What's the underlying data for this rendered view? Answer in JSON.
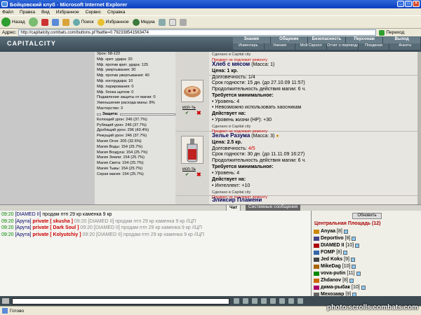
{
  "window": {
    "title": "Бойцовский клуб - Microsoft Internet Explorer"
  },
  "menu": [
    "Файл",
    "Правка",
    "Вид",
    "Избранное",
    "Сервис",
    "Справка"
  ],
  "toolbar": {
    "back": "Назад",
    "search": "Поиск",
    "favorites": "Избранное",
    "media": "Медиа"
  },
  "address": {
    "label": "Адрес:",
    "value": "http://capitalcity.combats.com/buttons.pl?battle=0.792338541563474",
    "go": "Переход"
  },
  "site": {
    "logo": "CAPITALCITY",
    "nav_top": [
      "Знания",
      "Общение",
      "Безопасность",
      "Персонаж",
      "Выход"
    ],
    "nav_bottom": [
      "Инвентарь",
      "Умения",
      "Мой Скролл",
      "Отчет о переводах",
      "Поединки",
      "Анкета"
    ]
  },
  "stats": {
    "lines_a": [
      "Урон: 58-122",
      "Мф. крит. удара: 20",
      "Мф. против крит. удара: 125",
      "Мф. увертывания: 30",
      "Мф. против увертывания: 40",
      "Мф. контрудара: 10",
      "Мф. парирования: 0",
      "Мф. блока щитом: 0",
      "Подавление защиты от магии: 0",
      "Уменьшение расхода маны: 8%",
      "Мастерство: 3"
    ],
    "protection": "Защита:",
    "lines_b": [
      "Колющий урон: 246 (37.7%)",
      "Рубящий урон: 246 (37.7%)",
      "Дробящий урон: 296 (43.4%)",
      "Режущий урон: 246 (37.7%)",
      "Магия Огня: 205 (32.6%)",
      "Магия Воды: 154 (25.7%)",
      "Магия Воздуха: 154 (25.7%)",
      "Магия Земли: 154 (25.7%)",
      "Магия Света: 154 (25.7%)",
      "Магия Тьмы: 154 (25.7%)",
      "Серая магия: 154 (25.7%)"
    ]
  },
  "shop": {
    "top_small": "Сделано в Capital city",
    "top_note": "Предмет не подлежит ремонту",
    "items": [
      {
        "name": "Хлеб с мясом",
        "mass": "(Масса: 1)",
        "price": "Цена: 1 кр.",
        "durability_label": "Долговечность: ",
        "durability": "1/4",
        "expiry": "Срок годности: 15 дн. (до 27.10.09 11:57)",
        "duration": "Продолжительность действия магии: 6 ч.",
        "req": "Требуется минимальное:",
        "req1": "• Уровень: 4",
        "req2": "• Невозможно использовать хаосникам",
        "effect": "Действует на:",
        "eff1": "• Уровень жизни (HP): +30",
        "made": "Сделано в Capital city",
        "note": "Предмет не подлежит ремонту",
        "buy": "исп-ть"
      },
      {
        "name": "Зелье Разума",
        "mass": "(Масса: 3)",
        "price": "Цена: 2.5 кр.",
        "durability_label": "Долговечность: ",
        "durability": "4/5",
        "expiry": "Срок годности: 30 дн. (до 11.11.09 16:27)",
        "duration": "Продолжительность действия магии: 6 ч.",
        "req": "Требуется минимальное:",
        "req1": "• Уровень: 4",
        "effect": "Действует на:",
        "eff1": "• Интеллект: +10",
        "made": "Сделано в Capital city",
        "note": "Предмет не подлежит ремонту",
        "buy": "исп-ть"
      }
    ],
    "next_item": "Эликсир Пламени"
  },
  "tabs": {
    "chat": "Чат",
    "system": "Системные сообщения"
  },
  "chat": [
    {
      "time": "09:20",
      "parts": [
        {
          "c": "nick",
          "t": "[DIAMED II]"
        },
        {
          "c": "txt",
          "t": " продам птп 29 кр каменка 9 кр"
        }
      ]
    },
    {
      "time": "09:20",
      "parts": [
        {
          "c": "nick",
          "t": "[Арута]"
        },
        {
          "c": "priv",
          "t": " private [ skusha ] "
        },
        {
          "c": "gr",
          "t": "09:20 [DIAMED II] продам птп 29 кр каменка 9 кр //ЦП"
        }
      ]
    },
    {
      "time": "09:20",
      "parts": [
        {
          "c": "nick",
          "t": "[Арута]"
        },
        {
          "c": "priv",
          "t": " private [ Dark Soul ] "
        },
        {
          "c": "gr",
          "t": "09:20 [DIAMED II] продам птп 29 кр каменка 9 кр //ЦП"
        }
      ]
    },
    {
      "time": "09:20",
      "parts": [
        {
          "c": "nick",
          "t": "[Арута]"
        },
        {
          "c": "priv",
          "t": " private [ Kolyutchiy ] "
        },
        {
          "c": "gr",
          "t": "09:20 [DIAMED II] продам птп 29 кр каменка 9 кр //ЦП"
        }
      ]
    }
  ],
  "users": {
    "refresh": "Обновить",
    "room": "Центральная Площадь (12)",
    "list": [
      {
        "name": "Anyaa",
        "level": "[8]",
        "color": "#c80"
      },
      {
        "name": "Deportivo",
        "level": "[8]",
        "color": "#448"
      },
      {
        "name": "DIAMED II",
        "level": "[10]",
        "color": "#a00"
      },
      {
        "name": "FOMP",
        "level": "[8]",
        "color": "#36a"
      },
      {
        "name": "Jed Koks",
        "level": "[9]",
        "color": "#444"
      },
      {
        "name": "MikeDag",
        "level": "[10]",
        "color": "#a60"
      },
      {
        "name": "vova-putin",
        "level": "[11]",
        "color": "#080"
      },
      {
        "name": "Zhdanov",
        "level": "[8]",
        "color": "#c60"
      },
      {
        "name": "дима-рыбак",
        "level": "[10]",
        "color": "#a06"
      },
      {
        "name": "Мехозавр",
        "level": "[9]",
        "color": "#666"
      },
      {
        "name": "ТОДЛ",
        "level": "[10]",
        "color": "#a06"
      }
    ]
  },
  "status": {
    "text": "Готово"
  },
  "watermark": "photo.scrolls.combats.com"
}
